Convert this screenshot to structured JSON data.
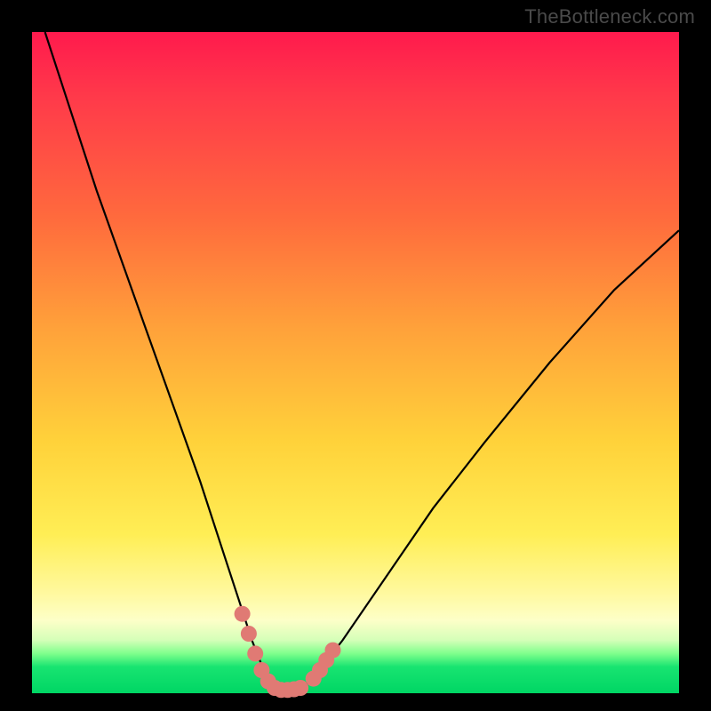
{
  "attribution": "TheBottleneck.com",
  "chart_data": {
    "type": "line",
    "title": "",
    "xlabel": "",
    "ylabel": "",
    "xlim": [
      0,
      100
    ],
    "ylim": [
      0,
      100
    ],
    "series": [
      {
        "name": "bottleneck-curve",
        "x": [
          2,
          6,
          10,
          14,
          18,
          22,
          26,
          30,
          32,
          34,
          36,
          37,
          38,
          40,
          42,
          44,
          48,
          55,
          62,
          70,
          80,
          90,
          100
        ],
        "y": [
          100,
          88,
          76,
          65,
          54,
          43,
          32,
          20,
          14,
          8,
          3,
          1,
          0.5,
          0.5,
          1,
          3,
          8,
          18,
          28,
          38,
          50,
          61,
          70
        ]
      }
    ],
    "markers": {
      "name": "highlighted-points",
      "color": "#e07a74",
      "points": [
        {
          "x": 32.5,
          "y": 12
        },
        {
          "x": 33.5,
          "y": 9
        },
        {
          "x": 34.5,
          "y": 6
        },
        {
          "x": 35.5,
          "y": 3.5
        },
        {
          "x": 36.5,
          "y": 1.8
        },
        {
          "x": 37.5,
          "y": 0.8
        },
        {
          "x": 38.5,
          "y": 0.5
        },
        {
          "x": 39.5,
          "y": 0.5
        },
        {
          "x": 40.5,
          "y": 0.6
        },
        {
          "x": 41.5,
          "y": 0.8
        },
        {
          "x": 43.5,
          "y": 2.2
        },
        {
          "x": 44.5,
          "y": 3.5
        },
        {
          "x": 45.5,
          "y": 5
        },
        {
          "x": 46.5,
          "y": 6.5
        }
      ]
    },
    "background_gradient": {
      "top": "#ff1a4d",
      "mid": "#ffd23a",
      "bottom": "#00d664"
    }
  }
}
